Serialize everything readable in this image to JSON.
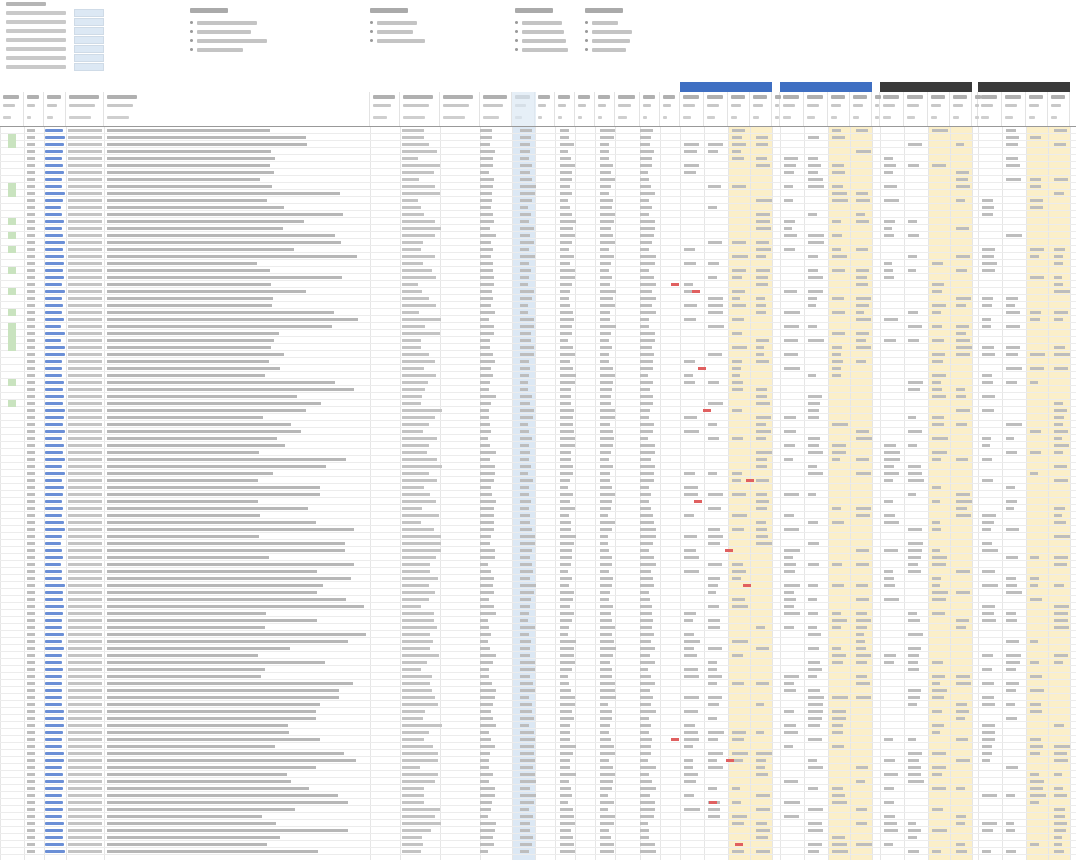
{
  "sheet": {
    "title": "",
    "settings": {
      "rows": [
        {
          "label": "",
          "value": ""
        },
        {
          "label": "",
          "value": ""
        },
        {
          "label": "",
          "value": ""
        },
        {
          "label": "",
          "value": ""
        },
        {
          "label": "",
          "value": ""
        },
        {
          "label": "",
          "value": ""
        },
        {
          "label": "",
          "value": ""
        }
      ]
    },
    "notes": [
      {
        "heading": "",
        "items": [
          "",
          "",
          "",
          ""
        ]
      },
      {
        "heading": "",
        "items": [
          "",
          "",
          ""
        ]
      },
      {
        "heading": "",
        "items": [
          "",
          "",
          "",
          ""
        ]
      },
      {
        "heading": "",
        "items": [
          "",
          "",
          "",
          ""
        ]
      }
    ],
    "group_headers": [
      {
        "label": "",
        "color": "#3f6fc2"
      },
      {
        "label": "",
        "color": "#3f6fc2"
      },
      {
        "label": "",
        "color": "#3a3a3a"
      },
      {
        "label": "",
        "color": "#3a3a3a"
      }
    ],
    "colors": {
      "group_blue": "#3f6fc2",
      "group_dark": "#3a3a3a",
      "highlight_yellow": "#fbefc9",
      "highlight_blue": "#dce8f4",
      "row_mark_green": "#c9e3bf",
      "link_blue": "#6b8fd6",
      "negative_red": "#e06060"
    }
  }
}
